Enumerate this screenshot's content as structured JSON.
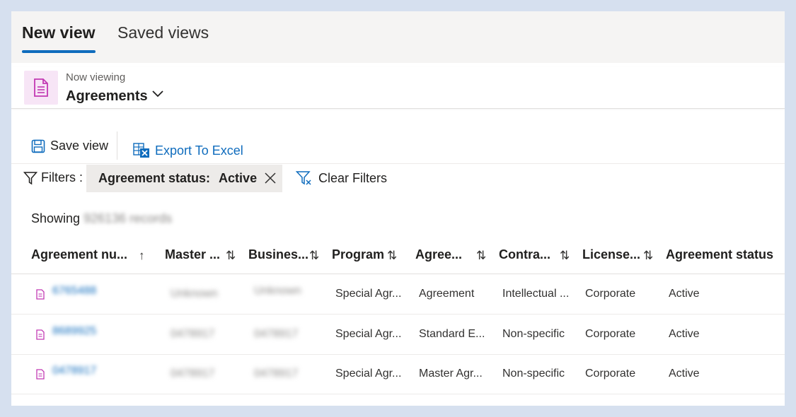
{
  "tabs": [
    {
      "label": "New view",
      "active": true
    },
    {
      "label": "Saved views",
      "active": false
    }
  ],
  "viewing": {
    "label": "Now viewing",
    "name": "Agreements"
  },
  "toolbar": {
    "save_label": "Save view",
    "export_label": "Export To Excel"
  },
  "filters": {
    "label": "Filters :",
    "chip_key": "Agreement status:",
    "chip_value": "Active",
    "clear_label": "Clear Filters"
  },
  "summary": {
    "showing": "Showing",
    "count": "926136 records"
  },
  "columns": [
    {
      "label": "Agreement nu...",
      "sort": "↑"
    },
    {
      "label": "Master ...",
      "sort": "⇅"
    },
    {
      "label": "Busines...",
      "sort": "⇅"
    },
    {
      "label": "Program",
      "sort": "⇅"
    },
    {
      "label": "Agree...",
      "sort": "⇅"
    },
    {
      "label": "Contra...",
      "sort": "⇅"
    },
    {
      "label": "License...",
      "sort": "⇅"
    },
    {
      "label": "Agreement status",
      "sort": ""
    }
  ],
  "rows": [
    {
      "agreement_number": "6765488",
      "master": "Unknown",
      "business": "Unknown",
      "program": "Special Agr...",
      "agreement": "Agreement",
      "contract": "Intellectual ...",
      "license": "Corporate",
      "status": "Active"
    },
    {
      "agreement_number": "8689925",
      "master": "0478917",
      "business": "0478917",
      "program": "Special Agr...",
      "agreement": "Standard E...",
      "contract": "Non-specific",
      "license": "Corporate",
      "status": "Active"
    },
    {
      "agreement_number": "0478917",
      "master": "0478917",
      "business": "0478917",
      "program": "Special Agr...",
      "agreement": "Master Agr...",
      "contract": "Non-specific",
      "license": "Corporate",
      "status": "Active"
    }
  ],
  "colors": {
    "accent": "#0f6cbd",
    "doc_icon": "#c239b3",
    "badge_bg": "#f7e5f6"
  }
}
